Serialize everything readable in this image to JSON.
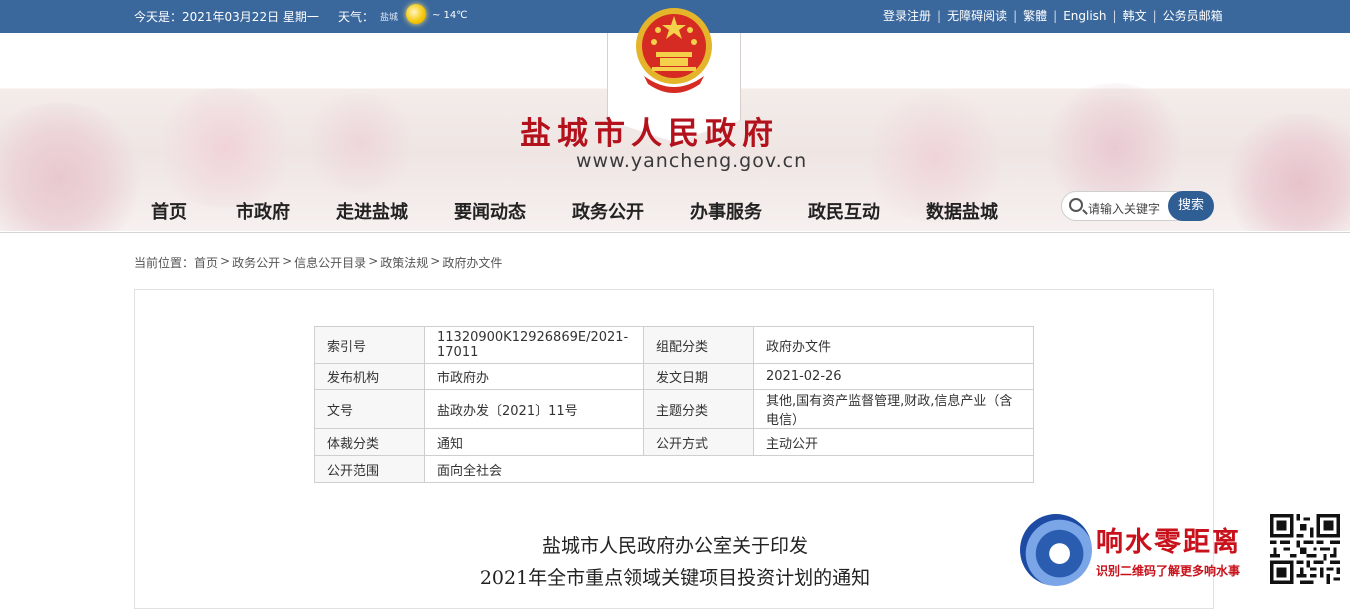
{
  "topbar": {
    "date": "今天是：2021年03月22日 星期一",
    "weather_label": "天气：",
    "weather_city": "盐城",
    "weather_icon": "sun-icon",
    "temperature": "~ 14℃",
    "links": [
      "登录注册",
      "无障碍阅读",
      "繁體",
      "English",
      "韩文",
      "公务员邮箱"
    ],
    "separator": "|"
  },
  "header": {
    "emblem_icon": "national-emblem-icon",
    "title": "盐城市人民政府",
    "url": "www.yancheng.gov.cn"
  },
  "nav": {
    "items": [
      "首页",
      "市政府",
      "走进盐城",
      "要闻动态",
      "政务公开",
      "办事服务",
      "政民互动",
      "数据盐城"
    ]
  },
  "search": {
    "placeholder": "请输入关键字",
    "button": "搜索"
  },
  "breadcrumb": {
    "prefix": "当前位置：",
    "items": [
      "首页",
      "政务公开",
      "信息公开目录",
      "政策法规",
      "政府办文件"
    ],
    "separator": ">"
  },
  "meta_table": {
    "rows": [
      {
        "k1": "索引号",
        "v1": "11320900K12926869E/2021-17011",
        "k2": "组配分类",
        "v2": "政府办文件"
      },
      {
        "k1": "发布机构",
        "v1": "市政府办",
        "k2": "发文日期",
        "v2": "2021-02-26"
      },
      {
        "k1": "文号",
        "v1": "盐政办发〔2021〕11号",
        "k2": "主题分类",
        "v2": "其他,国有资产监督管理,财政,信息产业（含电信）"
      },
      {
        "k1": "体裁分类",
        "v1": "通知",
        "k2": "公开方式",
        "v2": "主动公开"
      },
      {
        "k1": "公开范围",
        "v1": "面向全社会"
      }
    ]
  },
  "document": {
    "title_line1": "盐城市人民政府办公室关于印发",
    "title_line2": "2021年全市重点领域关键项目投资计划的通知"
  },
  "watermark": {
    "name": "响水零距离",
    "subtitle": "识别二维码了解更多响水事",
    "qr_icon": "qr-code-icon"
  },
  "colors": {
    "topbar": "#3a679c",
    "title_red": "#b3121c",
    "search_button": "#2f5e95"
  }
}
